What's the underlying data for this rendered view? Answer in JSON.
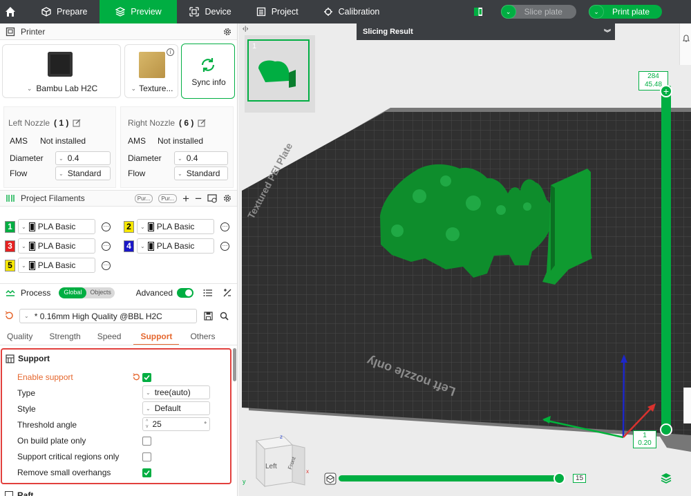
{
  "topbar": {
    "tabs": [
      {
        "label": "Prepare",
        "icon": "cube-icon"
      },
      {
        "label": "Preview",
        "icon": "layers-icon"
      },
      {
        "label": "Device",
        "icon": "device-icon"
      },
      {
        "label": "Project",
        "icon": "project-icon"
      },
      {
        "label": "Calibration",
        "icon": "calibration-icon"
      }
    ],
    "slice_label": "Slice plate",
    "print_label": "Print plate"
  },
  "printer": {
    "header": "Printer",
    "model": "Bambu Lab H2C",
    "plate": "Texture...",
    "sync_label": "Sync info",
    "left_nozzle": {
      "title": "Left Nozzle",
      "count": "( 1 )",
      "ams_label": "AMS",
      "ams_value": "Not installed",
      "diameter_label": "Diameter",
      "diameter": "0.4",
      "flow_label": "Flow",
      "flow": "Standard"
    },
    "right_nozzle": {
      "title": "Right Nozzle",
      "count": "( 6 )",
      "ams_label": "AMS",
      "ams_value": "Not installed",
      "diameter_label": "Diameter",
      "diameter": "0.4",
      "flow_label": "Flow",
      "flow": "Standard"
    }
  },
  "filaments": {
    "header": "Project Filaments",
    "purge1": "Pur...",
    "purge2": "Pur...",
    "items": [
      {
        "num": "1",
        "name": "PLA Basic",
        "color": "#00ae42"
      },
      {
        "num": "2",
        "name": "PLA Basic",
        "color": "#f5e600"
      },
      {
        "num": "3",
        "name": "PLA Basic",
        "color": "#e52020"
      },
      {
        "num": "4",
        "name": "PLA Basic",
        "color": "#1a17c7"
      },
      {
        "num": "5",
        "name": "PLA Basic",
        "color": "#f5e600"
      }
    ]
  },
  "process": {
    "header": "Process",
    "toggle_global": "Global",
    "toggle_objects": "Objects",
    "advanced_label": "Advanced",
    "preset": "* 0.16mm High Quality @BBL H2C",
    "tabs": [
      "Quality",
      "Strength",
      "Speed",
      "Support",
      "Others"
    ]
  },
  "support": {
    "title": "Support",
    "enable_label": "Enable support",
    "type_label": "Type",
    "type_value": "tree(auto)",
    "style_label": "Style",
    "style_value": "Default",
    "threshold_label": "Threshold angle",
    "threshold_value": "25",
    "threshold_unit": "°",
    "build_plate_label": "On build plate only",
    "critical_label": "Support critical regions only",
    "remove_label": "Remove small overhangs",
    "next_section": "Raft"
  },
  "viewport": {
    "slicing_result": "Slicing Result",
    "plate_number": "1",
    "layer_top": "284",
    "height_top": "45.48",
    "layer_bottom": "1",
    "height_bottom": "0.20",
    "move_value": "15",
    "plate_text": "Left nozzle only",
    "plate_brand": "Textured PEI Plate",
    "cube_left": "Left",
    "cube_front": "Front"
  }
}
